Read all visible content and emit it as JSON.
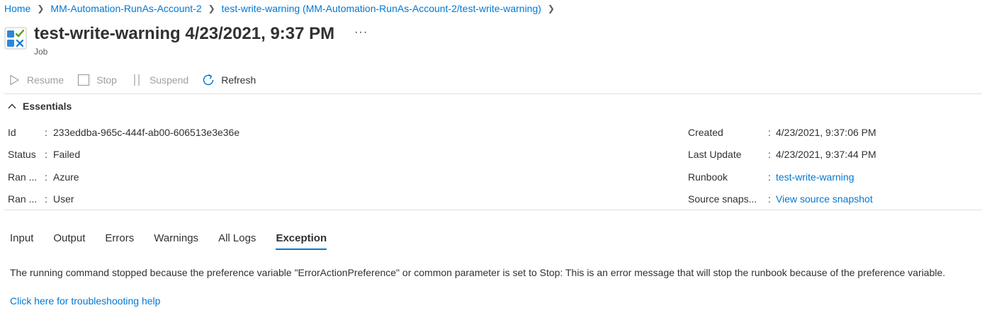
{
  "breadcrumb": {
    "items": [
      {
        "label": "Home"
      },
      {
        "label": "MM-Automation-RunAs-Account-2"
      },
      {
        "label": "test-write-warning (MM-Automation-RunAs-Account-2/test-write-warning)"
      }
    ]
  },
  "header": {
    "title": "test-write-warning 4/23/2021, 9:37 PM",
    "subtitle": "Job",
    "more_label": "···",
    "icon": "automation-job-icon"
  },
  "toolbar": {
    "resume_label": "Resume",
    "stop_label": "Stop",
    "suspend_label": "Suspend",
    "refresh_label": "Refresh"
  },
  "essentials": {
    "toggle_label": "Essentials",
    "left": [
      {
        "label": "Id",
        "value": "233eddba-965c-444f-ab00-606513e3e36e"
      },
      {
        "label": "Status",
        "value": "Failed"
      },
      {
        "label": "Ran ...",
        "value": "Azure"
      },
      {
        "label": "Ran ...",
        "value": "User"
      }
    ],
    "right": [
      {
        "label": "Created",
        "value": "4/23/2021, 9:37:06 PM"
      },
      {
        "label": "Last Update",
        "value": "4/23/2021, 9:37:44 PM"
      },
      {
        "label": "Runbook",
        "value": "test-write-warning"
      },
      {
        "label": "Source snaps...",
        "value": "View source snapshot"
      }
    ]
  },
  "tabs": [
    {
      "label": "Input"
    },
    {
      "label": "Output"
    },
    {
      "label": "Errors"
    },
    {
      "label": "Warnings"
    },
    {
      "label": "All Logs"
    },
    {
      "label": "Exception"
    }
  ],
  "active_tab": "Exception",
  "exception": {
    "message": "The running command stopped because the preference variable \"ErrorActionPreference\" or common parameter is set to Stop: This is an error message that will stop the runbook because of the preference variable.",
    "help_link": "Click here for troubleshooting help"
  },
  "colors": {
    "accent": "#0078d4",
    "text": "#323130",
    "disabled": "#a19f9d",
    "divider": "#e1dfdd"
  }
}
